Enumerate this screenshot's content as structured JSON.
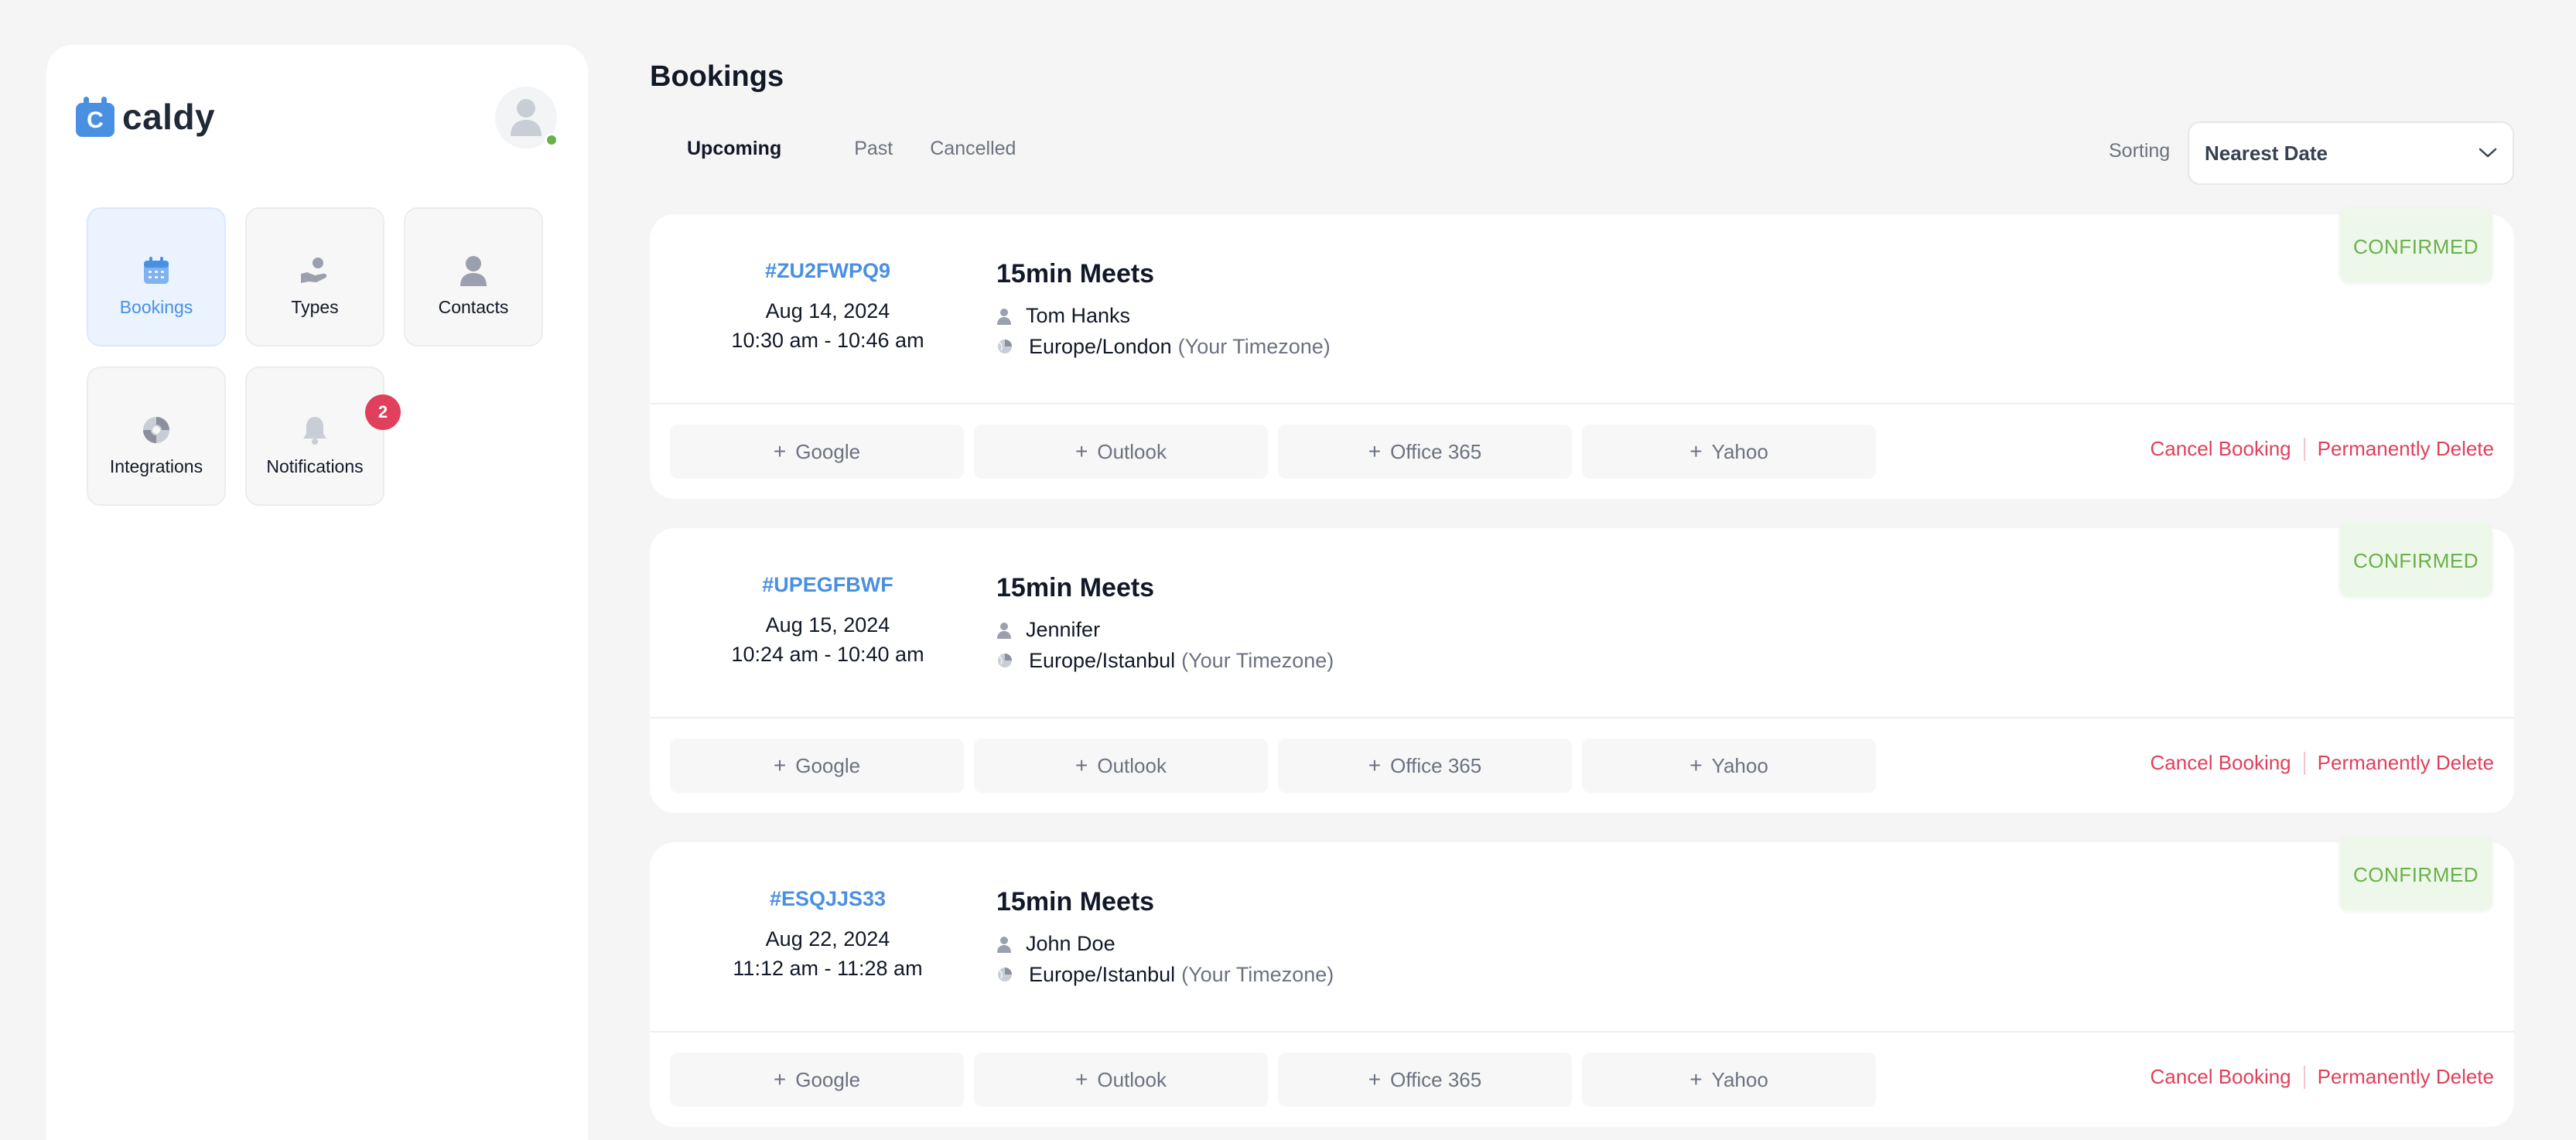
{
  "app": {
    "name": "caldy",
    "logo_letter": "C"
  },
  "sidebar": {
    "tiles": [
      {
        "label": "Bookings",
        "icon": "calendar-icon",
        "active": true
      },
      {
        "label": "Types",
        "icon": "hand-icon",
        "active": false
      },
      {
        "label": "Contacts",
        "icon": "user-icon",
        "active": false
      },
      {
        "label": "Integrations",
        "icon": "integrations-icon",
        "active": false
      },
      {
        "label": "Notifications",
        "icon": "bell-icon",
        "active": false,
        "badge": "2"
      }
    ]
  },
  "page": {
    "title": "Bookings"
  },
  "tabs": [
    {
      "label": "Upcoming",
      "active": true
    },
    {
      "label": "Past",
      "active": false
    },
    {
      "label": "Cancelled",
      "active": false
    }
  ],
  "sorting": {
    "label": "Sorting",
    "value": "Nearest Date"
  },
  "colors": {
    "accent": "#4a90e2",
    "danger": "#e0405b",
    "success": "#6ab04c"
  },
  "calendar_buttons": [
    "Google",
    "Outlook",
    "Office 365",
    "Yahoo"
  ],
  "actions": {
    "cancel": "Cancel Booking",
    "delete": "Permanently Delete"
  },
  "bookings": [
    {
      "code": "#ZU2FWPQ9",
      "date": "Aug 14, 2024",
      "time": "10:30 am - 10:46 am",
      "event": "15min Meets",
      "person": "Tom Hanks",
      "timezone": "Europe/London",
      "tz_hint": "(Your Timezone)",
      "status": "CONFIRMED"
    },
    {
      "code": "#UPEGFBWF",
      "date": "Aug 15, 2024",
      "time": "10:24 am - 10:40 am",
      "event": "15min Meets",
      "person": "Jennifer",
      "timezone": "Europe/Istanbul",
      "tz_hint": "(Your Timezone)",
      "status": "CONFIRMED"
    },
    {
      "code": "#ESQJJS33",
      "date": "Aug 22, 2024",
      "time": "11:12 am - 11:28 am",
      "event": "15min Meets",
      "person": "John Doe",
      "timezone": "Europe/Istanbul",
      "tz_hint": "(Your Timezone)",
      "status": "CONFIRMED"
    }
  ]
}
